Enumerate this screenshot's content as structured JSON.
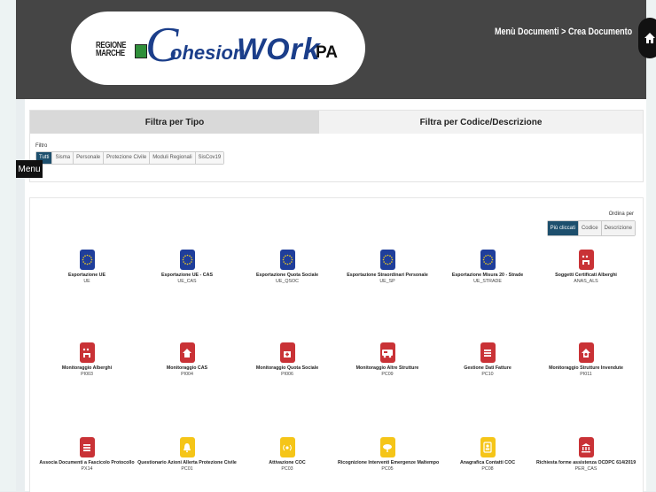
{
  "header": {
    "logo_region": "REGIONE\nMARCHE",
    "logo_c": "C",
    "logo_ohesion": "ohesion",
    "logo_work": "WOrk",
    "logo_pa": "PA",
    "breadcrumb": "Menù Documenti > Crea Documento"
  },
  "tabs": [
    {
      "label": "Filtra per Tipo"
    },
    {
      "label": "Filtra per Codice/Descrizione"
    }
  ],
  "filter": {
    "label": "Filtro",
    "chips": [
      "Tutti",
      "Sisma",
      "Personale",
      "Protezione Civile",
      "Moduli Regionali",
      "SisCov19"
    ]
  },
  "menu_label": "Menu",
  "sort": {
    "label": "Ordina per",
    "options": [
      "Più cliccati",
      "Codice",
      "Descrizione"
    ]
  },
  "documents": [
    {
      "name": "Esportazione UE",
      "code": "UE",
      "icon": "eu-flag-icon",
      "color": "#1f3e9b"
    },
    {
      "name": "Esportazione UE - CAS",
      "code": "UE_CAS",
      "icon": "eu-flag-icon",
      "color": "#1f3e9b"
    },
    {
      "name": "Esportazione Quota Sociale",
      "code": "UE_QSOC",
      "icon": "eu-flag-icon",
      "color": "#1f3e9b"
    },
    {
      "name": "Esportazione Straordinari Personale",
      "code": "UE_SP",
      "icon": "eu-flag-icon",
      "color": "#1f3e9b"
    },
    {
      "name": "Esportazione Misura 20 - Strade",
      "code": "UE_STRADE",
      "icon": "eu-flag-icon",
      "color": "#1f3e9b"
    },
    {
      "name": "Soggetti Certificati Alberghi",
      "code": "ANAS_ALS",
      "icon": "hotel-icon",
      "color": "#c93236"
    },
    {
      "name": "Monitoraggio Alberghi",
      "code": "PI003",
      "icon": "hotel-icon",
      "color": "#c93236"
    },
    {
      "name": "Monitoraggio CAS",
      "code": "PI004",
      "icon": "house-icon",
      "color": "#c93236"
    },
    {
      "name": "Monitoraggio Quota Sociale",
      "code": "PI006",
      "icon": "medkit-icon",
      "color": "#c93236"
    },
    {
      "name": "Monitoraggio Altre Strutture",
      "code": "PC09",
      "icon": "camper-icon",
      "color": "#c93236"
    },
    {
      "name": "Gestione Dati Fatture",
      "code": "PC10",
      "icon": "list-icon",
      "color": "#c93236"
    },
    {
      "name": "Monitoraggio Strutture Invendute",
      "code": "PI011",
      "icon": "home-euro-icon",
      "color": "#c93236"
    },
    {
      "name": "Associa Documenti a Fascicolo Protocollo",
      "code": "PX14",
      "icon": "list-icon",
      "color": "#c93236"
    },
    {
      "name": "Questionario Azioni Allerta Protezione Civile",
      "code": "PC01",
      "icon": "bell-icon",
      "color": "#f5c518"
    },
    {
      "name": "Attivazione COC",
      "code": "PC03",
      "icon": "broadcast-icon",
      "color": "#f5c518"
    },
    {
      "name": "Ricognizione Interventi Emergenze Maltempo",
      "code": "PC05",
      "icon": "cloud-icon",
      "color": "#f5c518"
    },
    {
      "name": "Anagrafica Contatti COC",
      "code": "PC08",
      "icon": "contact-icon",
      "color": "#f5c518"
    },
    {
      "name": "Richiesta forme assistenza OCDPC 614/2019",
      "code": "PER_CAS",
      "icon": "bank-icon",
      "color": "#c93236"
    }
  ]
}
